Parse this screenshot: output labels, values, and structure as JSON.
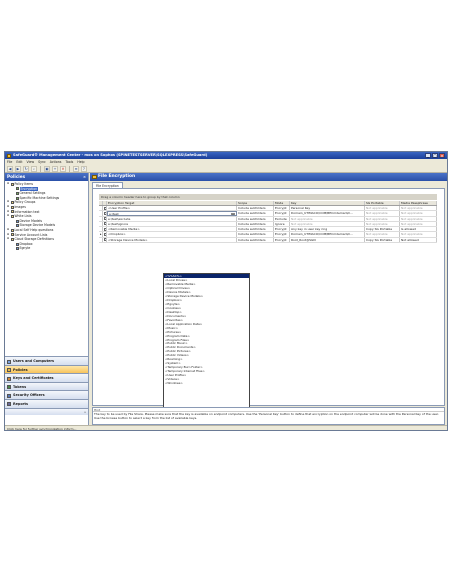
{
  "window": {
    "title": "SafeGuard® Management Center - mos on Sophos (SPINETESTSERVER\\SQLEXPRESS\\SafeGuard)",
    "controls": [
      "_",
      "□",
      "×"
    ]
  },
  "menu": [
    "File",
    "Edit",
    "View",
    "Sync",
    "Actions",
    "Tools",
    "Help"
  ],
  "toolbar_icons": [
    "back-icon",
    "forward-icon",
    "refresh-icon",
    "search-icon",
    "save-icon",
    "add-icon",
    "delete-icon",
    "properties-icon",
    "help-icon"
  ],
  "left_panel": {
    "title": "Policies",
    "tree": [
      {
        "label": "Policy Items",
        "indent": 0,
        "icon": "folder"
      },
      {
        "label": "Encryption",
        "indent": 1,
        "icon": "policy",
        "selected": true
      },
      {
        "label": "General Settings",
        "indent": 1,
        "icon": "policy"
      },
      {
        "label": "Specific Machine Settings",
        "indent": 1,
        "icon": "policy"
      },
      {
        "label": "Policy Groups",
        "indent": 0,
        "icon": "folder"
      },
      {
        "label": "Images",
        "indent": 0,
        "icon": "folder"
      },
      {
        "label": "Information text",
        "indent": 0,
        "icon": "folder"
      },
      {
        "label": "White Lists",
        "indent": 0,
        "icon": "folder"
      },
      {
        "label": "Device Models",
        "indent": 1,
        "icon": "device"
      },
      {
        "label": "Storage Device Models",
        "indent": 1,
        "icon": "device"
      },
      {
        "label": "Local Self Help questions",
        "indent": 0,
        "icon": "folder"
      },
      {
        "label": "Service Account Lists",
        "indent": 0,
        "icon": "folder"
      },
      {
        "label": "Cloud Storage Definitions",
        "indent": 0,
        "icon": "folder"
      },
      {
        "label": "Dropbox",
        "indent": 1,
        "icon": "cloud"
      },
      {
        "label": "Egnyte",
        "indent": 1,
        "icon": "cloud"
      }
    ],
    "nav_sections": [
      {
        "label": "Users and Computers",
        "active": false
      },
      {
        "label": "Policies",
        "active": true
      },
      {
        "label": "Keys and Certificates",
        "active": false
      },
      {
        "label": "Tokens",
        "active": false
      },
      {
        "label": "Security Officers",
        "active": false
      },
      {
        "label": "Reports",
        "active": false
      }
    ]
  },
  "right_panel": {
    "title": "File Encryption",
    "tab": "File Encryption",
    "group_hint": "Drag a column header here to group by that column",
    "columns": [
      "",
      "",
      "Encryption Target",
      "Scope",
      "Mode",
      "Key",
      "SG Portable",
      "Media Passphrase"
    ],
    "rows": [
      {
        "target": "<User Profile>",
        "scope": "Include subfolders",
        "mode": "Encrypt",
        "key": "Personal Key",
        "portable": "Not applicable",
        "passphrase": "Not applicable",
        "portable_gray": true,
        "passphrase_gray": true
      },
      {
        "target": "e:\\test",
        "scope": "Include subfolders",
        "mode": "Encrypt",
        "key": "Domain_UTIMACO\\COM\\BECmdeman\\D...",
        "portable": "Not applicable",
        "passphrase": "Not applicable",
        "portable_gray": true,
        "passphrase_gray": true,
        "editing": true
      },
      {
        "target": "e:\\test\\exclude",
        "scope": "Include subfolders",
        "mode": "Exclude",
        "key": "Not applicable",
        "portable": "Not applicable",
        "passphrase": "Not applicable",
        "key_gray": true,
        "portable_gray": true,
        "passphrase_gray": true
      },
      {
        "target": "e:\\test\\ignore",
        "scope": "Include subfolders",
        "mode": "Ignore",
        "key": "Not applicable",
        "portable": "Not applicable",
        "passphrase": "Not applicable",
        "key_gray": true,
        "portable_gray": true,
        "passphrase_gray": true
      },
      {
        "target": "<Removable Media>",
        "scope": "Include subfolders",
        "mode": "Encrypt",
        "key": "Any key in user key ring",
        "portable": "Copy SG Portable",
        "passphrase": "Is allowed"
      },
      {
        "target": "<Dropbox>",
        "scope": "Include subfolders",
        "mode": "Encrypt",
        "key": "Domain_UTIMACO\\COM\\BECmdeman\\D...",
        "portable": "Not applicable",
        "passphrase": "Not applicable",
        "portable_gray": true,
        "passphrase_gray": true
      },
      {
        "target": "<Storage Device Models>",
        "scope": "Include subfolders",
        "mode": "Encrypt",
        "key": "Root_Root@SGN",
        "portable": "Copy SG Portable",
        "passphrase": "Not allowed"
      }
    ],
    "dropdown_items": [
      "<%%SC%>",
      "<Local Drives>",
      "<Removable Media>",
      "<Optical Drives>",
      "<Device Models>",
      "<Storage Device Models>",
      "<Dropbox>",
      "<Egnyte>",
      "<Cookies>",
      "<Desktop>",
      "<Documents>",
      "<Favorites>",
      "<Local Application Data>",
      "<Music>",
      "<Pictures>",
      "<Program Data>",
      "<Program Files>",
      "<Public Music>",
      "<Public Documents>",
      "<Public Pictures>",
      "<Public Videos>",
      "<Roaming>",
      "<System>",
      "<Temporary Burn Folder>",
      "<Temporary Internet Files>",
      "<User Profile>",
      "<Videos>",
      "<Windows>"
    ],
    "dropdown_selected": 0,
    "info_label": "Hint",
    "info_text": "The key to be used by File Share. Please make sure that the key is available on endpoint computers. Use the 'Personal Key' button to define that encryption on the endpoint computer will be done with the Personal Key of the user. Use the browse button to select a key from the list of available keys."
  },
  "status_bar": "Click here for further synchronization inform..."
}
